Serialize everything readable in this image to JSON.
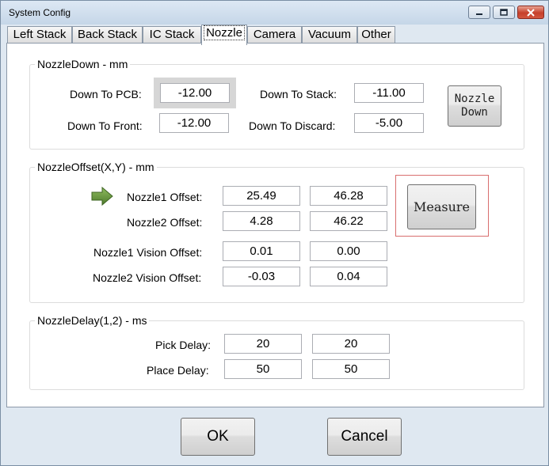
{
  "window": {
    "title": "System Config"
  },
  "icons": {
    "minimize": "minimize-icon",
    "maximize": "maximize-icon",
    "close": "close-icon",
    "pointer": "green-arrow-icon"
  },
  "tabs": [
    {
      "label": "Left Stack"
    },
    {
      "label": "Back Stack"
    },
    {
      "label": "IC Stack"
    },
    {
      "label": "Nozzle"
    },
    {
      "label": "Camera"
    },
    {
      "label": "Vacuum"
    },
    {
      "label": "Other"
    }
  ],
  "active_tab": "Nozzle",
  "nozzle_down": {
    "title": "NozzleDown - mm",
    "pcb_label": "Down To PCB:",
    "pcb_value": "-12.00",
    "stack_label": "Down To Stack:",
    "stack_value": "-11.00",
    "front_label": "Down To Front:",
    "front_value": "-12.00",
    "discard_label": "Down To Discard:",
    "discard_value": "-5.00",
    "button_line1": "Nozzle",
    "button_line2": "Down"
  },
  "nozzle_offset": {
    "title": "NozzleOffset(X,Y) - mm",
    "rows": [
      {
        "label": "Nozzle1 Offset:",
        "x": "25.49",
        "y": "46.28"
      },
      {
        "label": "Nozzle2 Offset:",
        "x": "4.28",
        "y": "46.22"
      },
      {
        "label": "Nozzle1 Vision Offset:",
        "x": "0.01",
        "y": "0.00"
      },
      {
        "label": "Nozzle2 Vision Offset:",
        "x": "-0.03",
        "y": "0.04"
      }
    ],
    "measure_label": "Measure"
  },
  "nozzle_delay": {
    "title": "NozzleDelay(1,2) - ms",
    "rows": [
      {
        "label": "Pick Delay:",
        "v1": "20",
        "v2": "20"
      },
      {
        "label": "Place Delay:",
        "v1": "50",
        "v2": "50"
      }
    ]
  },
  "footer": {
    "ok_label": "OK",
    "cancel_label": "Cancel"
  },
  "colors": {
    "accent_frame": "#d86e6e",
    "arrow": "#5f8a3a"
  }
}
